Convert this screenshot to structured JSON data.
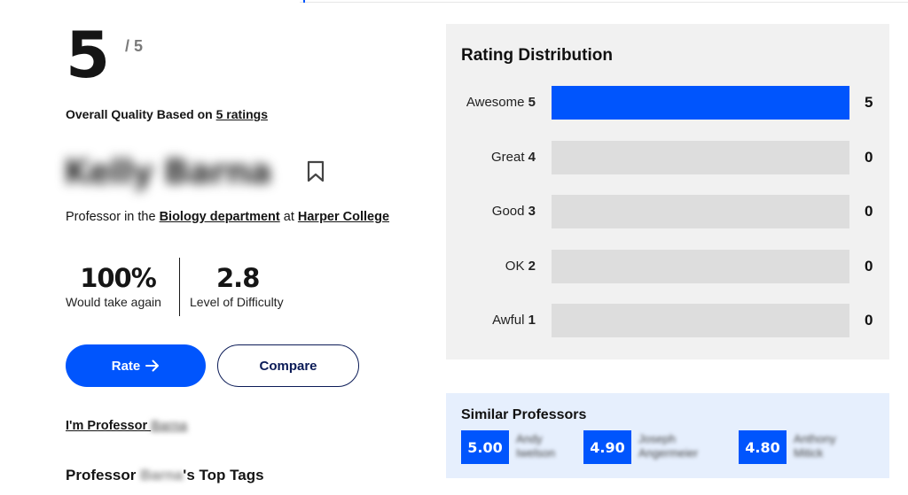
{
  "summary": {
    "score": "5",
    "score_max": "/ 5",
    "overall_text": "Overall Quality Based on ",
    "ratings_link": "5 ratings"
  },
  "professor": {
    "name": "Kelly Barna",
    "dept_prefix": "Professor in the ",
    "department": "Biology department",
    "at_text": " at ",
    "school": "Harper College"
  },
  "stats": [
    {
      "value": "100%",
      "label": "Would take again"
    },
    {
      "value": "2.8",
      "label": "Level of Difficulty"
    }
  ],
  "actions": {
    "rate_label": "Rate",
    "compare_label": "Compare"
  },
  "im_professor": {
    "prefix": "I'm Professor ",
    "name": "Barna"
  },
  "top_tags": {
    "prefix": "Professor ",
    "name": "Barna",
    "suffix": "'s Top Tags"
  },
  "distribution": {
    "title": "Rating Distribution",
    "rows": [
      {
        "label": "Awesome",
        "num": "5",
        "count": 5,
        "fill": 1.0
      },
      {
        "label": "Great",
        "num": "4",
        "count": 0,
        "fill": 0
      },
      {
        "label": "Good",
        "num": "3",
        "count": 0,
        "fill": 0
      },
      {
        "label": "OK",
        "num": "2",
        "count": 0,
        "fill": 0
      },
      {
        "label": "Awful",
        "num": "1",
        "count": 0,
        "fill": 0
      }
    ]
  },
  "similar": {
    "title": "Similar Professors",
    "items": [
      {
        "score": "5.00",
        "first": "Andy",
        "last": "Iwelson"
      },
      {
        "score": "4.90",
        "first": "Joseph",
        "last": "Angermeier"
      },
      {
        "score": "4.80",
        "first": "Anthony",
        "last": "Mitick"
      }
    ]
  },
  "colors": {
    "accent": "#0055fd",
    "panel_bg": "#f1f1f1",
    "similar_bg": "#e6effd",
    "track": "#dddddd"
  }
}
